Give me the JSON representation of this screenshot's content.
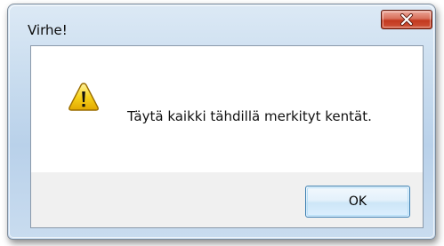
{
  "dialog": {
    "title": "Virhe!",
    "message": "Täytä kaikki tähdillä merkityt kentät.",
    "ok_label": "OK",
    "close_icon": "close-icon",
    "message_icon": "warning-icon"
  },
  "colors": {
    "close_button": "#c9452b",
    "ok_border": "#3c7fb1",
    "warning_yellow": "#f7d21c"
  }
}
